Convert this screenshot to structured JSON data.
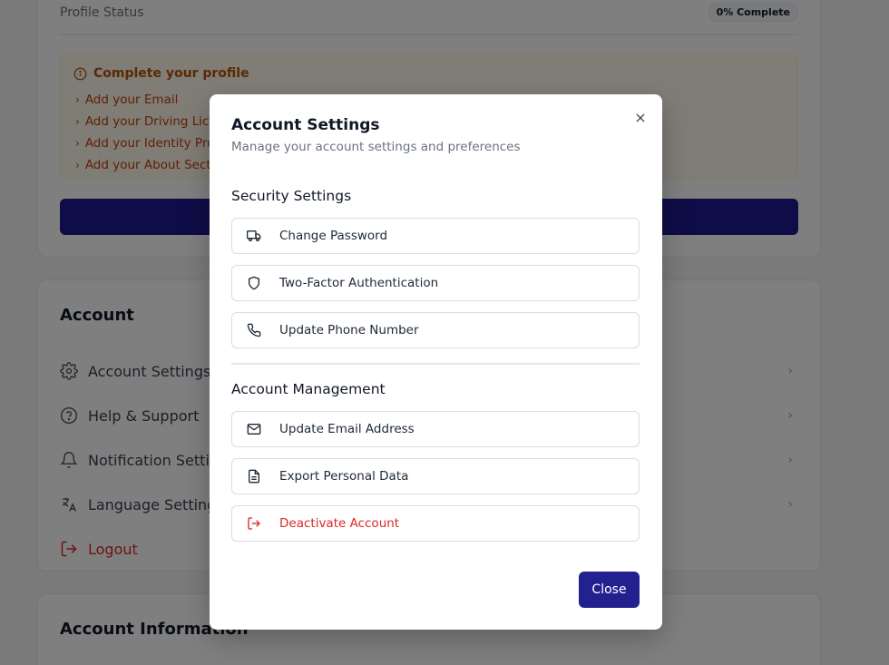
{
  "background": {
    "profile": {
      "status_label": "Profile Status",
      "status_badge": "0% Complete",
      "complete_title": "Complete your profile",
      "items": [
        "Add your Email",
        "Add your Driving Licen",
        "Add your Identity Pro",
        "Add your About Sectio"
      ]
    },
    "account": {
      "title": "Account",
      "rows": [
        {
          "label": "Account Settings",
          "icon": "gear-icon"
        },
        {
          "label": "Help & Support",
          "icon": "question-circle-icon"
        },
        {
          "label": "Notification Settin",
          "icon": "bell-icon"
        },
        {
          "label": "Language Settings",
          "icon": "translate-icon"
        },
        {
          "label": "Logout",
          "icon": "logout-icon"
        }
      ]
    },
    "info": {
      "title": "Account Information"
    }
  },
  "modal": {
    "title": "Account Settings",
    "subtitle": "Manage your account settings and preferences",
    "security": {
      "heading": "Security Settings",
      "options": [
        {
          "label": "Change Password",
          "icon": "truck-icon"
        },
        {
          "label": "Two-Factor Authentication",
          "icon": "shield-icon"
        },
        {
          "label": "Update Phone Number",
          "icon": "phone-icon"
        }
      ]
    },
    "management": {
      "heading": "Account Management",
      "options": [
        {
          "label": "Update Email Address",
          "icon": "mail-icon"
        },
        {
          "label": "Export Personal Data",
          "icon": "document-icon"
        },
        {
          "label": "Deactivate Account",
          "icon": "logout-icon"
        }
      ]
    },
    "close_label": "Close"
  },
  "colors": {
    "primary": "#23208f",
    "danger": "#dc2626",
    "warning_text": "#b45309"
  }
}
